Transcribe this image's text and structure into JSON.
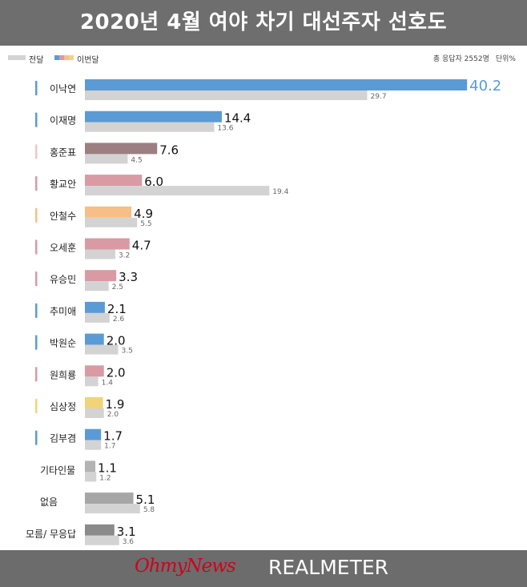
{
  "title": "2020년 4월 여야 차기 대선주자 선호도",
  "legend": {
    "prev_label": "전달",
    "curr_label": "이번달",
    "prev_color": "#d3d3d3",
    "curr_colors": [
      "#5b9bd5",
      "#d99aa3",
      "#f7bf87",
      "#f1d37a"
    ]
  },
  "meta": {
    "respondents": "총 응답자 2552명",
    "unit": "단위%"
  },
  "brand": {
    "ohmynews": "OhmyNews",
    "realmeter": "REALMETER"
  },
  "chart_data": {
    "type": "bar",
    "orientation": "horizontal",
    "categories": [
      "이낙연",
      "이재명",
      "홍준표",
      "황교안",
      "안철수",
      "오세훈",
      "유승민",
      "추미애",
      "박원순",
      "원희룡",
      "심상정",
      "김부겸",
      "기타인물",
      "없음",
      "모름/ 무응답"
    ],
    "series": [
      {
        "name": "이번달",
        "values": [
          40.2,
          14.4,
          7.6,
          6.0,
          4.9,
          4.7,
          3.3,
          2.1,
          2.0,
          2.0,
          1.9,
          1.7,
          1.1,
          5.1,
          3.1
        ],
        "labels": [
          "40.2",
          "14.4",
          "7.6",
          "6.0",
          "4.9",
          "4.7",
          "3.3",
          "2.1",
          "2.0",
          "2.0",
          "1.9",
          "1.7",
          "1.1",
          "5.1",
          "3.1"
        ]
      },
      {
        "name": "전달",
        "values": [
          29.7,
          13.6,
          4.5,
          19.4,
          5.5,
          3.2,
          2.5,
          2.6,
          3.5,
          1.4,
          2.0,
          1.7,
          1.2,
          5.8,
          3.6
        ],
        "labels": [
          "29.7",
          "13.6",
          "4.5",
          "19.4",
          "5.5",
          "3.2",
          "2.5",
          "2.6",
          "3.5",
          "1.4",
          "2.0",
          "1.7",
          "1.2",
          "5.8",
          "3.6"
        ]
      }
    ],
    "current_colors": [
      "#5b9bd5",
      "#5b9bd5",
      "#9c7f80",
      "#d99aa3",
      "#f7bf87",
      "#d99aa3",
      "#d99aa3",
      "#5b9bd5",
      "#5b9bd5",
      "#d99aa3",
      "#f1d37a",
      "#5b9bd5",
      "#b3b3b3",
      "#a6a6a6",
      "#8a8a8a"
    ],
    "party_marker_colors": [
      "#5b9bd5",
      "#5b9bd5",
      "#e8c9cc",
      "#d99aa3",
      "#f7bf87",
      "#d99aa3",
      "#d99aa3",
      "#5b9bd5",
      "#5b9bd5",
      "#d99aa3",
      "#f1d37a",
      "#5b9bd5",
      "",
      "",
      ""
    ],
    "highlight_color": "#5b9bd5",
    "grid": false,
    "legend_position": "top-left"
  }
}
